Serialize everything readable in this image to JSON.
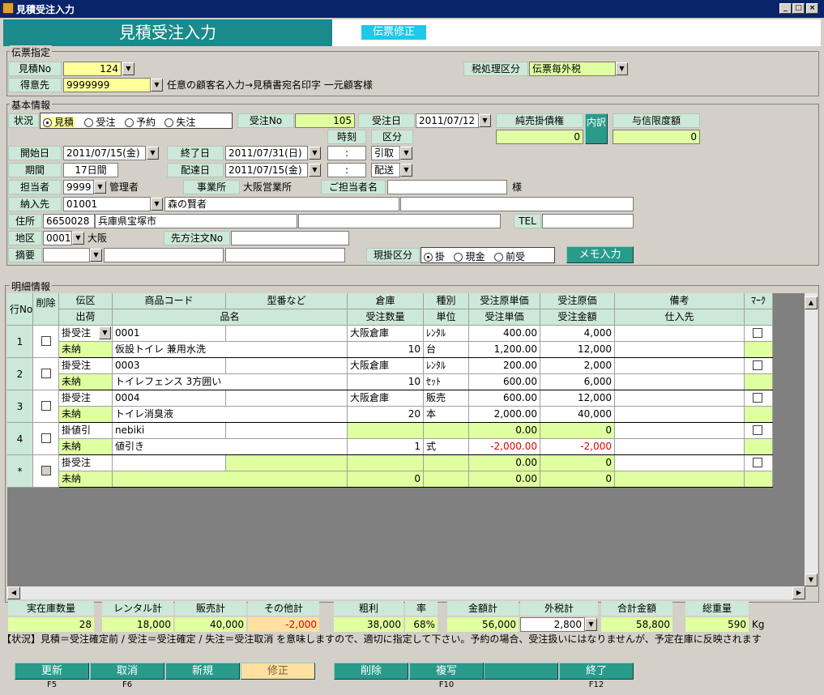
{
  "window": {
    "title": "見積受注入力"
  },
  "header": {
    "title": "見積受注入力",
    "mode": "伝票修正"
  },
  "slip": {
    "group_label": "伝票指定",
    "mitsumori_no_label": "見積No",
    "mitsumori_no": "124",
    "tokuisaki_label": "得意先",
    "tokuisaki_code": "9999999",
    "tokuisaki_note": "任意の顧客名入力→見積書宛名印字 一元顧客様",
    "tax_label": "税処理区分",
    "tax_value": "伝票毎外税"
  },
  "basic": {
    "group_label": "基本情報",
    "status_label": "状況",
    "status_options": [
      "見積",
      "受注",
      "予約",
      "失注"
    ],
    "juchu_no_label": "受注No",
    "juchu_no": "105",
    "juchu_date_label": "受注日",
    "juchu_date": "2011/07/12",
    "credit_label": "純売掛債権",
    "credit_value": "0",
    "uchiwake_label": "内訳",
    "limit_label": "与信限度額",
    "limit_value": "0",
    "jikoku_label": "時刻",
    "kubun_label": "区分",
    "start_label": "開始日",
    "start_date": "2011/07/15(金)",
    "end_label": "終了日",
    "end_date": "2011/07/31(日)",
    "time1": " : ",
    "kubun1": "引取",
    "kikan_label": "期間",
    "kikan_value": "17日間",
    "haitatsu_label": "配達日",
    "haitatsu_date": "2011/07/15(金)",
    "time2": " : ",
    "kubun2": "配送",
    "tanto_label": "担当者",
    "tanto_code": "9999",
    "tanto_name": "管理者",
    "jigyosho_label": "事業所",
    "jigyosho_value": "大阪営業所",
    "gotanto_label": "ご担当者名",
    "sama": "様",
    "nonyu_label": "納入先",
    "nonyu_code": "01001",
    "nonyu_name": "森の賢者",
    "address_label": "住所",
    "zip": "6650028",
    "address": "兵庫県宝塚市",
    "tel_label": "TEL",
    "area_label": "地区",
    "area_code": "0001",
    "area_name": "大阪",
    "sakichumon_label": "先方注文No",
    "tekiyo_label": "摘要",
    "genkake_label": "現掛区分",
    "genkake_options": [
      "掛",
      "現金",
      "前受"
    ],
    "memo_button": "メモ入力"
  },
  "detail": {
    "group_label": "明細情報",
    "headers_top": [
      "行No",
      "削除",
      "伝区",
      "商品コード",
      "型番など",
      "倉庫",
      "種別",
      "受注原単価",
      "受注原価",
      "備考",
      "ﾏｰｸ"
    ],
    "headers_bottom": [
      "出荷",
      "品名",
      "受注数量",
      "単位",
      "受注単価",
      "受注金額",
      "仕入先"
    ],
    "rows": [
      {
        "no": "1",
        "denku": "掛受注",
        "code": "0001",
        "soko": "大阪倉庫",
        "shubetsu": "ﾚﾝﾀﾙ",
        "gentanka": "400.00",
        "genka": "4,000",
        "shukka": "未納",
        "hinmei": "仮設トイレ 兼用水洗",
        "qty": "10",
        "tani": "台",
        "tanka": "1,200.00",
        "kingaku": "12,000"
      },
      {
        "no": "2",
        "denku": "掛受注",
        "code": "0003",
        "soko": "大阪倉庫",
        "shubetsu": "ﾚﾝﾀﾙ",
        "gentanka": "200.00",
        "genka": "2,000",
        "shukka": "未納",
        "hinmei": "トイレフェンス 3方囲い",
        "qty": "10",
        "tani": "ｾｯﾄ",
        "tanka": "600.00",
        "kingaku": "6,000"
      },
      {
        "no": "3",
        "denku": "掛受注",
        "code": "0004",
        "soko": "大阪倉庫",
        "shubetsu": "販売",
        "gentanka": "600.00",
        "genka": "12,000",
        "shukka": "未納",
        "hinmei": "トイレ消臭液",
        "qty": "20",
        "tani": "本",
        "tanka": "2,000.00",
        "kingaku": "40,000"
      },
      {
        "no": "4",
        "denku": "掛値引",
        "code": "nebiki",
        "soko": "",
        "shubetsu": "",
        "gentanka": "0.00",
        "genka": "0",
        "shukka": "未納",
        "hinmei": "値引き",
        "qty": "1",
        "tani": "式",
        "tanka": "-2,000.00",
        "kingaku": "-2,000"
      },
      {
        "no": "*",
        "denku": "掛受注",
        "code": "",
        "soko": "",
        "shubetsu": "",
        "gentanka": "0.00",
        "genka": "0",
        "shukka": "未納",
        "hinmei": "",
        "qty": "0",
        "tani": "",
        "tanka": "0.00",
        "kingaku": "0"
      }
    ]
  },
  "totals": {
    "zaiko_label": "実在庫数量",
    "zaiko": "28",
    "rental_label": "レンタル計",
    "rental": "18,000",
    "hanbai_label": "販売計",
    "hanbai": "40,000",
    "sonota_label": "その他計",
    "sonota": "-2,000",
    "arari_label": "粗利",
    "arari": "38,000",
    "ritsu_label": "率",
    "ritsu": "68%",
    "kingaku_label": "金額計",
    "kingaku": "56,000",
    "sotozei_label": "外税計",
    "sotozei": "2,800",
    "gokei_label": "合計金額",
    "gokei": "58,800",
    "juryo_label": "総重量",
    "juryo": "590",
    "juryo_unit": "Kg"
  },
  "note": "【状況】見積＝受注確定前 / 受注＝受注確定 / 失注＝受注取消 を意味しますので、適切に指定して下さい。予約の場合、受注扱いにはなりませんが、予定在庫に反映されます",
  "buttons": [
    {
      "label": "更新",
      "key": "F5"
    },
    {
      "label": "取消",
      "key": "F6"
    },
    {
      "label": "新規",
      "key": ""
    },
    {
      "label": "修正",
      "key": ""
    },
    {
      "label": "削除",
      "key": ""
    },
    {
      "label": "複写",
      "key": "F10"
    },
    {
      "label": "",
      "key": ""
    },
    {
      "label": "終了",
      "key": "F12"
    }
  ]
}
